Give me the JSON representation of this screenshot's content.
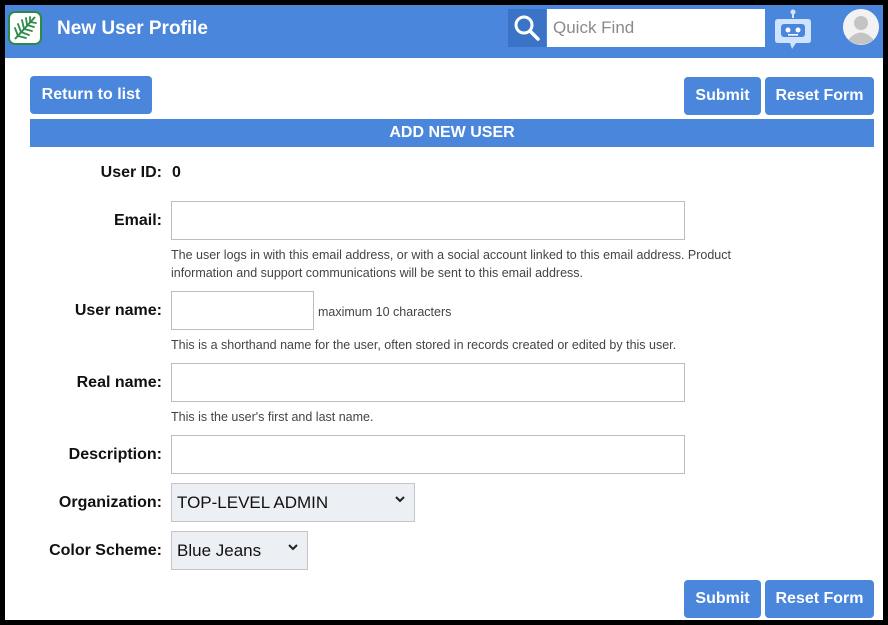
{
  "header": {
    "title": "New User Profile",
    "search_placeholder": "Quick Find",
    "search_value": ""
  },
  "actions": {
    "return_label": "Return to list",
    "submit_label": "Submit",
    "reset_label": "Reset Form"
  },
  "section_title": "ADD NEW USER",
  "form": {
    "user_id": {
      "label": "User ID:",
      "value": "0"
    },
    "email": {
      "label": "Email:",
      "value": "",
      "help": "The user logs in with this email address, or with a social account linked to this email address. Product information and support communications will be sent to this email address."
    },
    "user_name": {
      "label": "User name:",
      "value": "",
      "hint": "maximum 10 characters",
      "help": "This is a shorthand name for the user, often stored in records created or edited by this user."
    },
    "real_name": {
      "label": "Real name:",
      "value": "",
      "help": "This is the user's first and last name."
    },
    "description": {
      "label": "Description:",
      "value": ""
    },
    "organization": {
      "label": "Organization:",
      "selected": "TOP-LEVEL ADMIN"
    },
    "color_scheme": {
      "label": "Color Scheme:",
      "selected": "Blue Jeans"
    }
  },
  "colors": {
    "accent": "#4a86dc",
    "accent_dark": "#3b73c6",
    "logo_green": "#2f8a4a"
  },
  "icons": {
    "logo": "fern-leaf-logo-icon",
    "search": "magnifier-icon",
    "assistant": "robot-chat-icon",
    "profile": "user-avatar-icon",
    "dropdown": "chevron-down-icon"
  }
}
